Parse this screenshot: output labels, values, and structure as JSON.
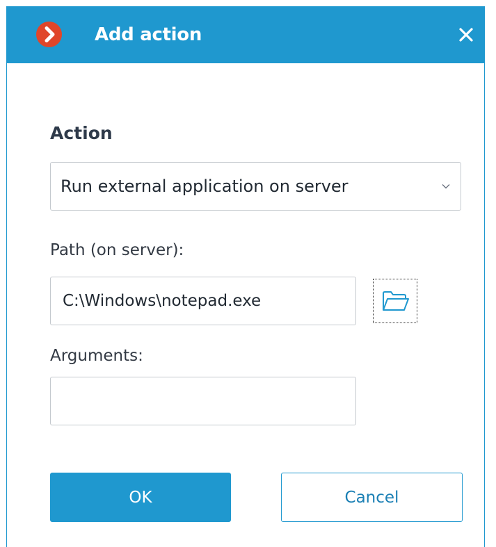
{
  "dialog": {
    "title": "Add action",
    "logo_icon": "app-logo-chevron-icon",
    "close_icon": "close-icon",
    "accent_color": "#1f98cf",
    "logo_color": "#e0462a"
  },
  "action": {
    "label": "Action",
    "selected": "Run external application on server",
    "dropdown_icon": "chevron-down-icon"
  },
  "path": {
    "label": "Path (on server):",
    "value": "C:\\Windows\\notepad.exe",
    "browse_icon": "folder-open-icon"
  },
  "arguments": {
    "label": "Arguments:",
    "value": ""
  },
  "buttons": {
    "ok_label": "OK",
    "cancel_label": "Cancel"
  }
}
